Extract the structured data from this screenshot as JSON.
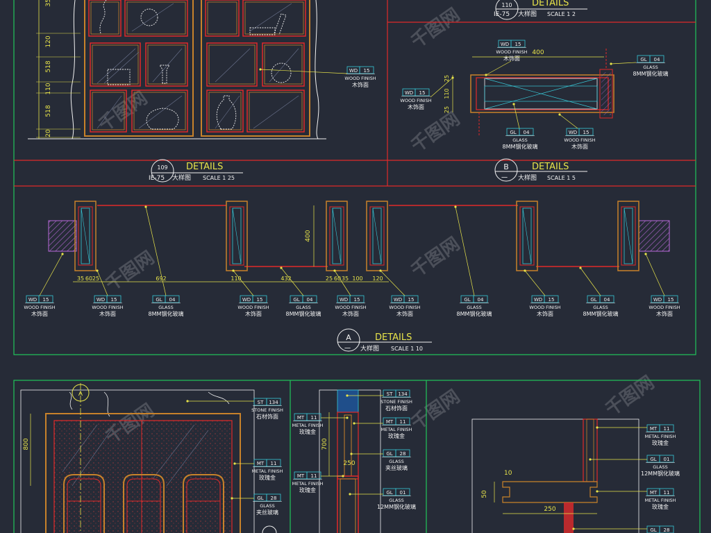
{
  "colors": {
    "bg": "#262b37",
    "frame": "#21c55a",
    "red": "#e02a2a",
    "yellow": "#e8e44a",
    "white": "#f2f2f2",
    "cyan": "#38c9d8",
    "orange": "#c8822a"
  },
  "titles": {
    "t109": {
      "num": "109",
      "ref": "IE-75",
      "label": "DETAILS",
      "sub": "大样图",
      "scale": "SCALE 1 25"
    },
    "t110": {
      "num": "110",
      "ref": "IE-75",
      "label": "DETAILS",
      "sub": "大样图",
      "scale": "SCALE 1 2"
    },
    "tB": {
      "letter": "B",
      "dash": "一",
      "label": "DETAILS",
      "sub": "大样图",
      "scale": "SCALE 1 5"
    },
    "tA": {
      "letter": "A",
      "dash": "一",
      "label": "DETAILS",
      "sub": "大样图",
      "scale": "SCALE 1 10"
    }
  },
  "dims": {
    "left_top": [
      "120",
      "518",
      "110",
      "518",
      "20",
      "35"
    ],
    "b_width": "400",
    "b_left": [
      "25",
      "110",
      "25"
    ],
    "a_height": "400",
    "a_row": [
      "35",
      "60",
      "25",
      "692",
      "110",
      "432",
      "25",
      "60",
      "35",
      "100",
      "120"
    ],
    "c_height": "800",
    "d_heights": [
      "700",
      "250"
    ],
    "e_values": [
      "10",
      "50",
      "250"
    ]
  },
  "tags": {
    "wd15": {
      "code": "WD",
      "num": "15",
      "en": "WOOD FINISH",
      "cn": "木饰面"
    },
    "gl04": {
      "code": "GL",
      "num": "04",
      "en": "GLASS",
      "cn": "8MM钢化玻璃"
    },
    "st134": {
      "code": "ST",
      "num": "134",
      "en": "STONE FINISH",
      "cn": "石材饰面"
    },
    "mt11": {
      "code": "MT",
      "num": "11",
      "en": "METAL FINISH",
      "cn": "玫瑰金"
    },
    "gl28": {
      "code": "GL",
      "num": "28",
      "en": "GLASS",
      "cn": "夹丝玻璃"
    },
    "gl01": {
      "code": "GL",
      "num": "01",
      "en": "GLASS",
      "cn": "12MM钢化玻璃"
    }
  },
  "watermark": "千图网"
}
